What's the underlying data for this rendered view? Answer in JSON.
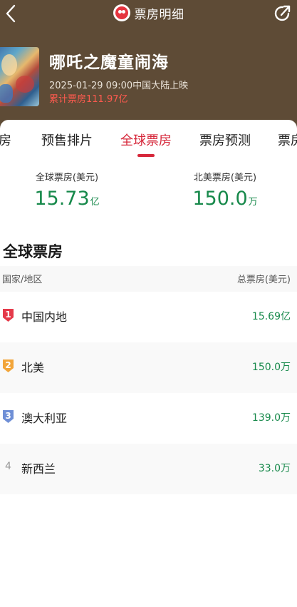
{
  "header": {
    "title": "票房明细"
  },
  "movie": {
    "title": "哪吒之魔童闹海",
    "release": "2025-01-29 09:00中国大陆上映",
    "total_box_office": "累计票房111.97亿"
  },
  "tabs": [
    {
      "label": "房",
      "active": false
    },
    {
      "label": "预售排片",
      "active": false
    },
    {
      "label": "全球票房",
      "active": true
    },
    {
      "label": "票房预测",
      "active": false
    },
    {
      "label": "票房",
      "active": false
    }
  ],
  "summary": {
    "global": {
      "label": "全球票房(美元)",
      "value": "15.73",
      "unit": "亿"
    },
    "north_america": {
      "label": "北美票房(美元)",
      "value": "150.0",
      "unit": "万"
    }
  },
  "section_title": "全球票房",
  "table": {
    "headers": {
      "region": "国家/地区",
      "gross": "总票房(美元)"
    },
    "rows": [
      {
        "rank": "1",
        "country": "中国内地",
        "gross": "15.69亿",
        "badge_color": "#e53a4a"
      },
      {
        "rank": "2",
        "country": "北美",
        "gross": "150.0万",
        "badge_color": "#f2a53a"
      },
      {
        "rank": "3",
        "country": "澳大利亚",
        "gross": "139.0万",
        "badge_color": "#6f8fd6"
      },
      {
        "rank": "4",
        "country": "新西兰",
        "gross": "33.0万",
        "badge_color": ""
      }
    ]
  },
  "colors": {
    "header_bg": "#5e4b36",
    "accent_red": "#d6273a",
    "value_green": "#17894b",
    "total_red": "#ff5a4f"
  },
  "icons": {
    "back": "back-arrow-icon",
    "share": "share-icon",
    "logo": "maoyan-cat-logo-icon"
  }
}
